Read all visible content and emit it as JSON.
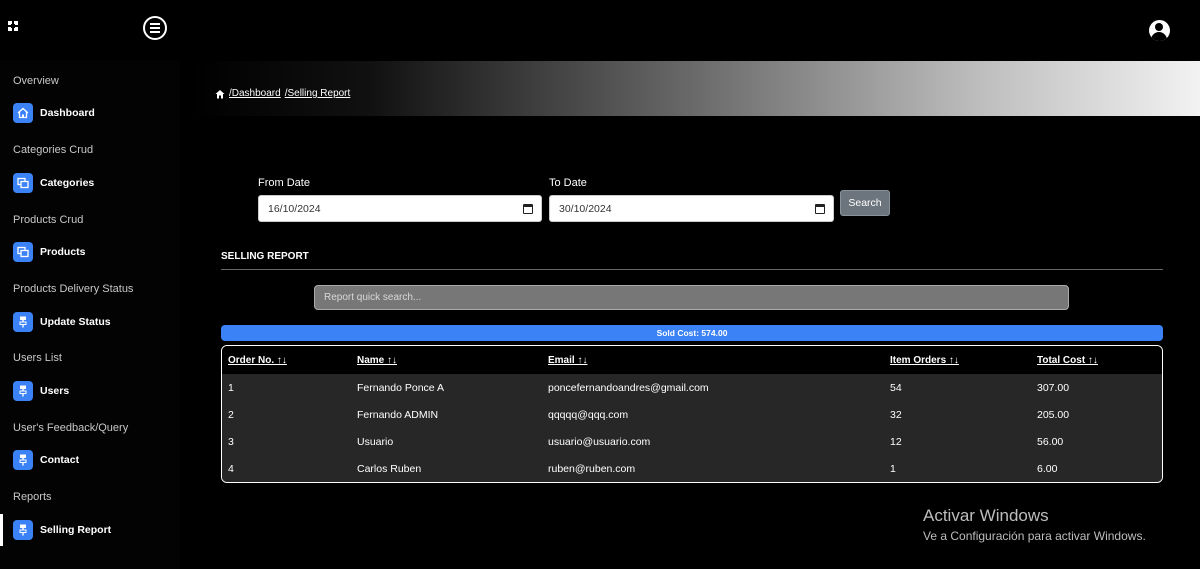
{
  "header": {
    "logo_icon": "app-logo-icon",
    "menu_icon": "hamburger-menu-icon",
    "user_icon": "user-avatar-icon"
  },
  "sidebar": {
    "sections": [
      {
        "title": "Overview",
        "item": {
          "label": "Dashboard",
          "icon": "home-icon"
        }
      },
      {
        "title": "Categories Crud",
        "item": {
          "label": "Categories",
          "icon": "copy-icon"
        }
      },
      {
        "title": "Products Crud",
        "item": {
          "label": "Products",
          "icon": "copy-icon"
        }
      },
      {
        "title": "Products Delivery Status",
        "item": {
          "label": "Update Status",
          "icon": "sitemap-icon"
        }
      },
      {
        "title": "Users List",
        "item": {
          "label": "Users",
          "icon": "sitemap-icon"
        }
      },
      {
        "title": "User's Feedback/Query",
        "item": {
          "label": "Contact",
          "icon": "sitemap-icon"
        }
      },
      {
        "title": "Reports",
        "item": {
          "label": "Selling Report",
          "icon": "sitemap-icon",
          "active": true
        }
      }
    ]
  },
  "breadcrumb": {
    "items": [
      "/Dashboard",
      "/Selling Report"
    ]
  },
  "filters": {
    "from_label": "From Date",
    "from_value": "16/10/2024",
    "to_label": "To Date",
    "to_value": "30/10/2024",
    "search_label": "Search"
  },
  "report": {
    "title": "SELLING REPORT",
    "search_placeholder": "Report quick search...",
    "sold_cost": "Sold Cost: 574.00",
    "columns": [
      "Order No. ↑↓",
      "Name ↑↓",
      "Email ↑↓",
      "Item Orders ↑↓",
      "Total Cost ↑↓"
    ],
    "rows": [
      [
        "1",
        "Fernando Ponce A",
        "poncefernandoandres@gmail.com",
        "54",
        "307.00"
      ],
      [
        "2",
        "Fernando ADMIN",
        "qqqqq@qqq.com",
        "32",
        "205.00"
      ],
      [
        "3",
        "Usuario",
        "usuario@usuario.com",
        "12",
        "56.00"
      ],
      [
        "4",
        "Carlos Ruben",
        "ruben@ruben.com",
        "1",
        "6.00"
      ]
    ]
  },
  "watermark": {
    "line1": "Activar Windows",
    "line2": "Ve a Configuración para activar Windows."
  },
  "colors": {
    "accent": "#3b82f6",
    "background": "#000000",
    "table_body": "#272727",
    "button": "#6c757d"
  }
}
